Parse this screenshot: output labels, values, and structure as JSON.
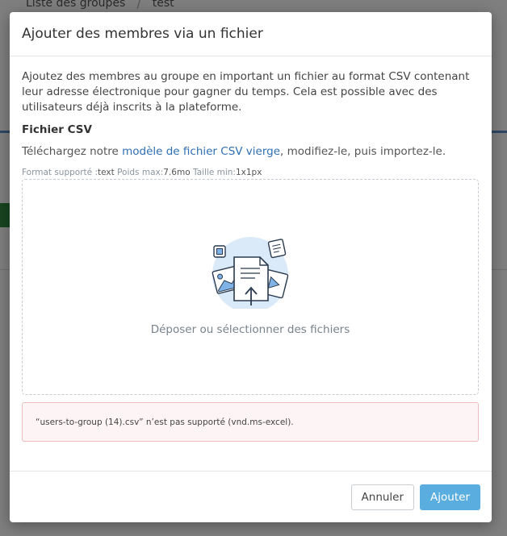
{
  "background": {
    "breadcrumb": [
      "Liste des groupes",
      "test"
    ]
  },
  "modal": {
    "title": "Ajouter des membres via un fichier",
    "intro": "Ajoutez des membres au groupe en important un fichier au format CSV contenant leur adresse électronique pour gagner du temps. Cela est possible avec des utilisateurs déjà inscrits à la plateforme.",
    "section_title": "Fichier CSV",
    "download_prefix": "Téléchargez notre ",
    "download_link": "modèle de fichier CSV vierge",
    "download_suffix": ", modifiez-le, puis importez-le.",
    "format": {
      "format_label": "Format supporté :",
      "format_value": "text",
      "weight_label": " Poids max:",
      "weight_value": "7.6mo",
      "size_label": " Taille min:",
      "size_value": "1x1px"
    },
    "dropzone_text": "Déposer ou sélectionner des fichiers",
    "error_message": "“users-to-group (14).csv” n’est pas supporté (vnd.ms-excel).",
    "buttons": {
      "cancel": "Annuler",
      "add": "Ajouter"
    }
  },
  "colors": {
    "link": "#2f6fb3",
    "primary_button": "#5aaedf",
    "error_bg": "#fdf5f5",
    "error_border": "#eebcbc"
  },
  "icons": {
    "upload_illustration": "file-upload-illustration"
  }
}
